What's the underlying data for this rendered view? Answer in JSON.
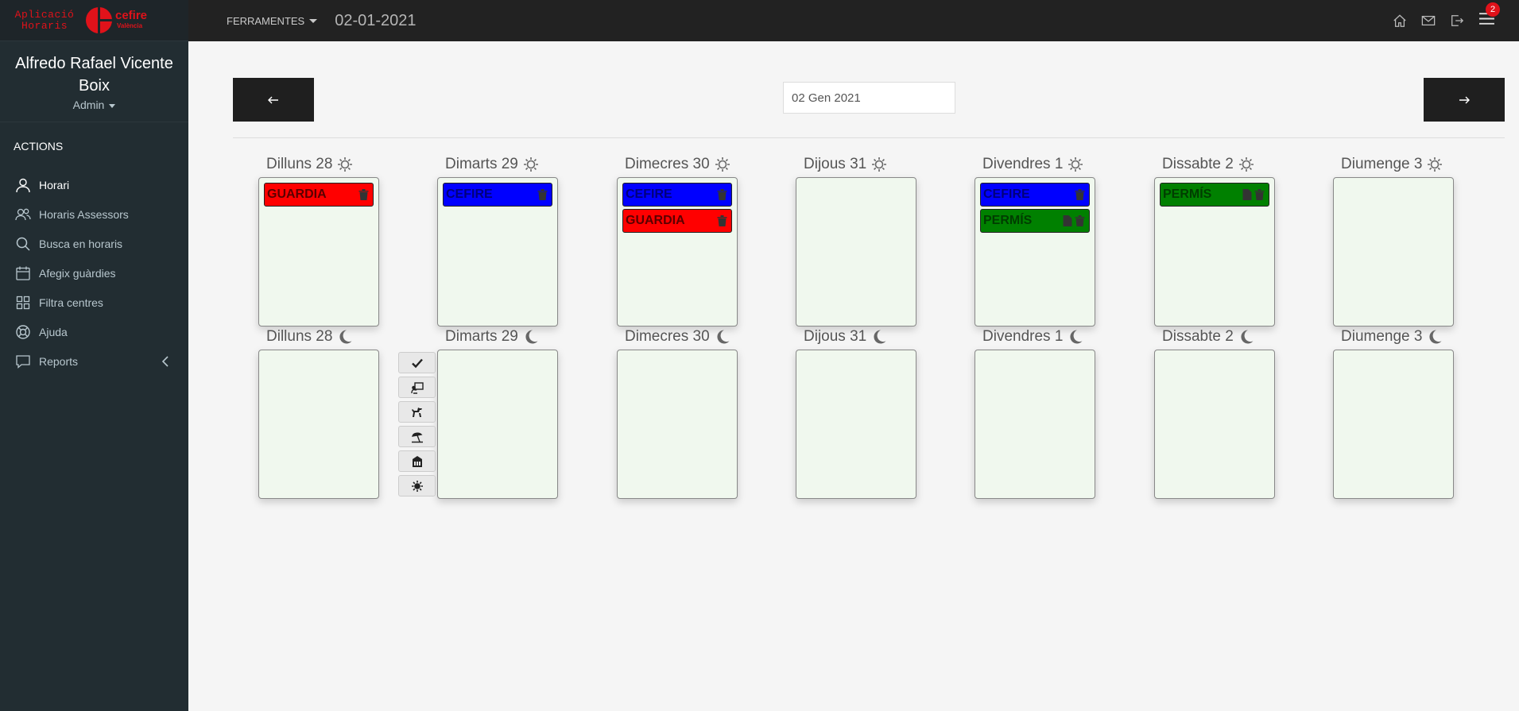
{
  "brand": {
    "app_line1": "Aplicació",
    "app_line2": "Horaris",
    "logo_word": "cefire",
    "logo_sub": "València"
  },
  "user": {
    "name": "Alfredo Rafael Vicente Boix",
    "role": "Admin"
  },
  "sidebar": {
    "header": "ACTIONS",
    "items": [
      {
        "label": "Horari",
        "icon": "user-icon"
      },
      {
        "label": "Horaris Assessors",
        "icon": "users-icon"
      },
      {
        "label": "Busca en horaris",
        "icon": "search-icon"
      },
      {
        "label": "Afegix guàrdies",
        "icon": "calendar-icon"
      },
      {
        "label": "Filtra centres",
        "icon": "grid-icon"
      },
      {
        "label": "Ajuda",
        "icon": "lifebuoy-icon"
      },
      {
        "label": "Reports",
        "icon": "chat-icon"
      }
    ]
  },
  "topbar": {
    "tools_label": "FERRAMENTES",
    "date": "02-01-2021",
    "notification_count": "2"
  },
  "content": {
    "date_input_value": "02 Gen 2021",
    "morning_days": [
      "Dilluns 28",
      "Dimarts 29",
      "Dimecres 30",
      "Dijous 31",
      "Divendres 1",
      "Dissabte 2",
      "Diumenge 3"
    ],
    "afternoon_days": [
      "Dilluns 28",
      "Dimarts 29",
      "Dimecres 30",
      "Dijous 31",
      "Divendres 1",
      "Dissabte 2",
      "Diumenge 3"
    ],
    "events": {
      "mon": [
        "GUARDIA"
      ],
      "tue": [
        "CEFIRE"
      ],
      "wed": [
        "CEFIRE",
        "GUARDIA"
      ],
      "fri": [
        "CEFIRE",
        "PERMÍS"
      ],
      "sat": [
        "PERMÍS"
      ]
    },
    "event_colors": {
      "GUARDIA": "#ff0000",
      "CEFIRE": "#0000ff",
      "PERMÍS": "#008000"
    },
    "tool_icons": [
      "check-icon",
      "teacher-board-icon",
      "dog-walk-icon",
      "beach-umbrella-icon",
      "school-building-icon",
      "sun-icon"
    ]
  }
}
